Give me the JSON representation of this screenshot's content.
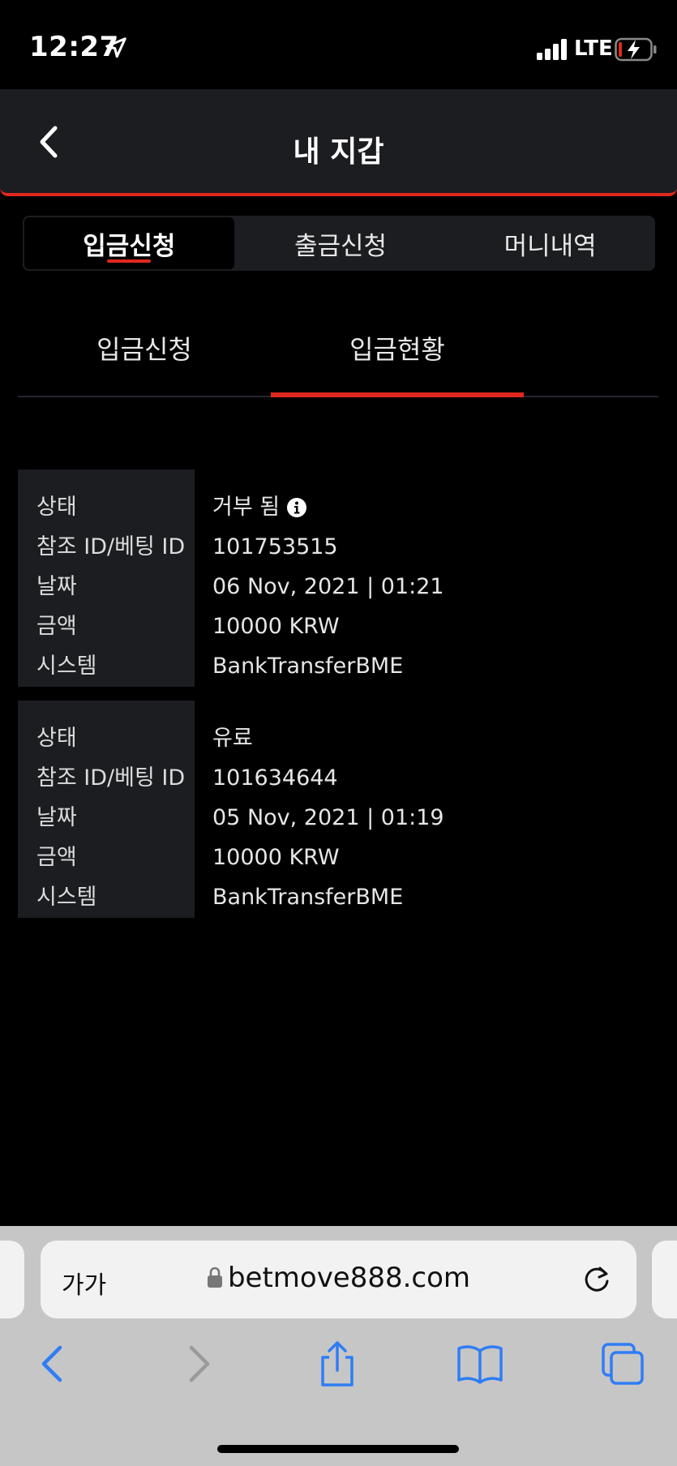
{
  "status_bar": {
    "time": "12:27",
    "network": "LTE"
  },
  "header": {
    "title": "내 지갑"
  },
  "top_tabs": [
    {
      "label": "입금신청",
      "active": true
    },
    {
      "label": "출금신청",
      "active": false
    },
    {
      "label": "머니내역",
      "active": false
    }
  ],
  "sub_tabs": [
    {
      "label": "입금신청",
      "active": false
    },
    {
      "label": "입금현황",
      "active": true
    }
  ],
  "records": [
    {
      "labels": [
        "상태",
        "참조 ID/베팅 ID",
        "날짜",
        "금액",
        "시스템"
      ],
      "status": "거부 됨",
      "ref_id": "101753515",
      "date": "06 Nov, 2021 | 01:21",
      "amount": "10000 KRW",
      "system": "BankTransferBME"
    },
    {
      "labels": [
        "상태",
        "참조 ID/베팅 ID",
        "날짜",
        "금액",
        "시스템"
      ],
      "status": "유료",
      "ref_id": "101634644",
      "date": "05 Nov, 2021 | 01:19",
      "amount": "10000 KRW",
      "system": "BankTransferBME"
    }
  ],
  "browser": {
    "text_size_label": "가가",
    "url": "betmove888.com"
  },
  "colors": {
    "accent": "#e0281e",
    "panel": "#1c1d21",
    "background": "#000000",
    "ios_blue": "#2f7df6"
  }
}
